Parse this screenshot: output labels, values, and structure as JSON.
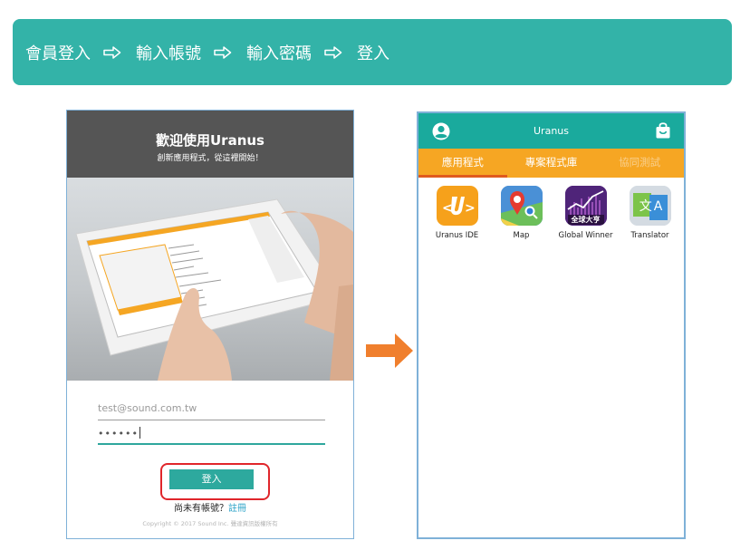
{
  "banner": {
    "steps": [
      "會員登入",
      "輸入帳號",
      "輸入密碼",
      "登入"
    ],
    "arrow_icon": "hollow-arrow-right-icon",
    "color": "#33b3a8"
  },
  "login_screen": {
    "title": "歡迎使用Uranus",
    "subtitle": "創新應用程式，從這裡開始！",
    "carousel_pages": 3,
    "carousel_active": 1,
    "email_value": "test@sound.com.tw",
    "password_value": "••••••",
    "login_button": "登入",
    "register_prompt": "尚未有帳號？",
    "register_link": "註冊",
    "copyright": "Copyright © 2017 Sound Inc. 聲達資訊版權所有",
    "highlight_color": "#e0262b"
  },
  "transition_arrow": {
    "color": "#f07f2d"
  },
  "app_screen": {
    "title": "Uranus",
    "user_icon": "user-circle-icon",
    "bag_icon": "shopping-bag-icon",
    "tabs": [
      {
        "label": "應用程式",
        "active": true
      },
      {
        "label": "專案程式庫",
        "active": false
      },
      {
        "label": "協同測試",
        "active": false
      }
    ],
    "apps": [
      {
        "label": "Uranus IDE",
        "icon": "uranus-ide-icon"
      },
      {
        "label": "Map",
        "icon": "map-icon"
      },
      {
        "label": "Global Winner",
        "icon": "global-winner-icon",
        "icon_text": "全球大亨"
      },
      {
        "label": "Translator",
        "icon": "translator-icon",
        "icon_text": "文A"
      }
    ],
    "header_color": "#1aaa9d",
    "tab_color": "#f6a623"
  }
}
